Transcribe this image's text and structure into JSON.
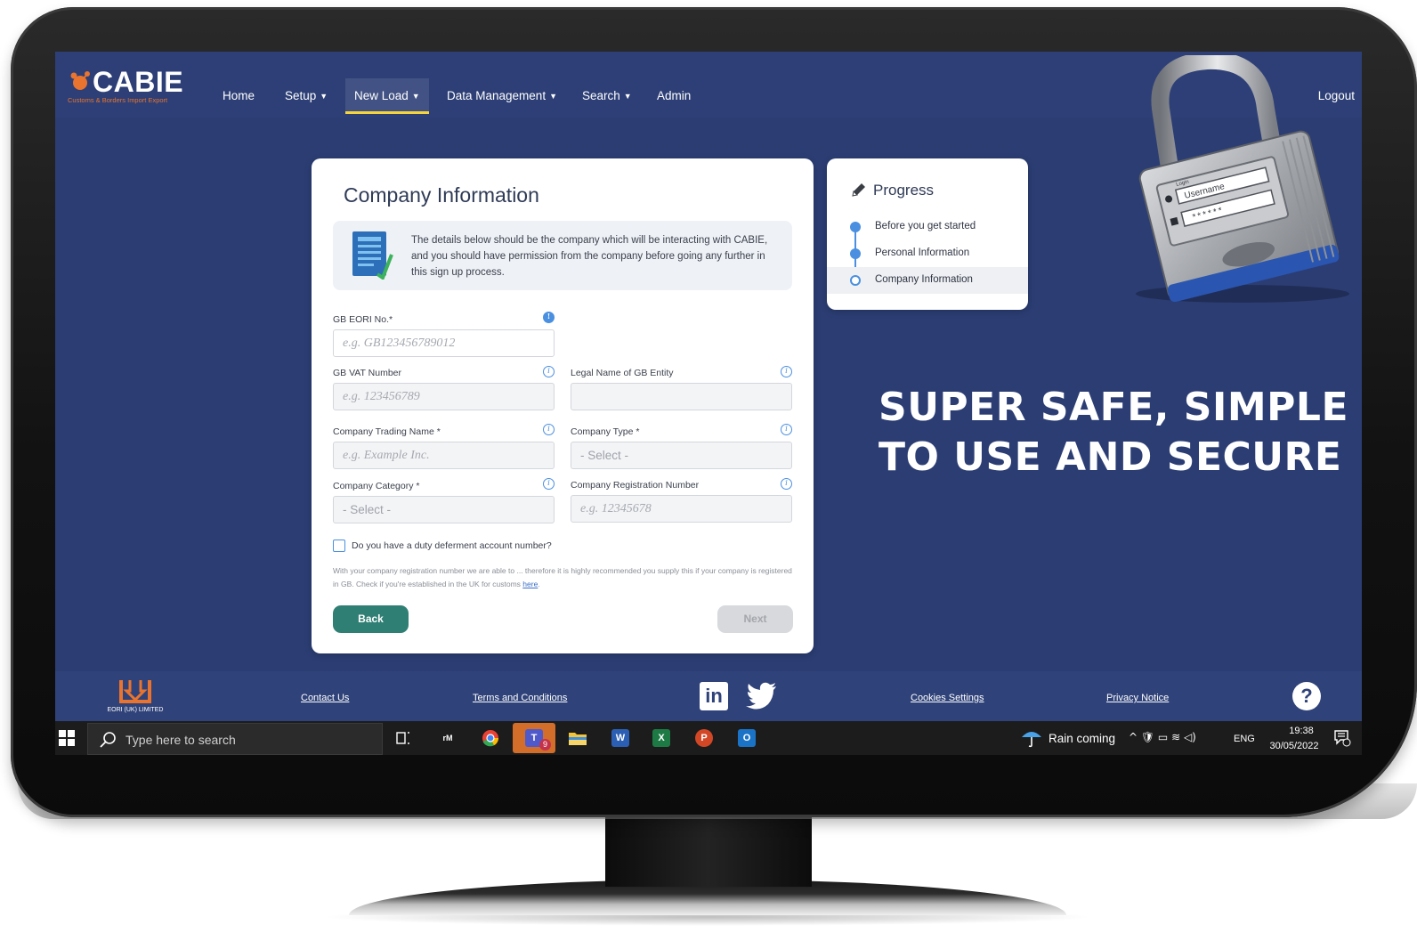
{
  "brand": {
    "name": "CABIE",
    "tagline": "Customs & Borders Import Export",
    "accent": "#e8742f",
    "primary": "#2b3d73"
  },
  "nav": {
    "items": [
      {
        "label": "Home",
        "has_menu": false
      },
      {
        "label": "Setup",
        "has_menu": true
      },
      {
        "label": "New Load",
        "has_menu": true,
        "active": true
      },
      {
        "label": "Data Management",
        "has_menu": true
      },
      {
        "label": "Search",
        "has_menu": true
      },
      {
        "label": "Admin",
        "has_menu": false
      }
    ],
    "logout": "Logout"
  },
  "form": {
    "title": "Company Information",
    "info_icon": "document-check-icon",
    "info_text": "The details below should be the company which will be interacting with CABIE, and you should have permission from the company before going any further in this sign up process.",
    "fields": {
      "eori": {
        "label": "GB EORI No.*",
        "placeholder": "e.g. GB123456789012"
      },
      "vat": {
        "label": "GB VAT Number",
        "placeholder": "e.g. 123456789"
      },
      "legal_name": {
        "label": "Legal Name of GB Entity",
        "placeholder": ""
      },
      "trading_name": {
        "label": "Company Trading Name *",
        "placeholder": "e.g. Example Inc."
      },
      "company_type": {
        "label": "Company Type *",
        "value": "- Select -"
      },
      "category": {
        "label": "Company Category *",
        "value": "- Select -"
      },
      "reg_number": {
        "label": "Company Registration Number",
        "placeholder": "e.g. 12345678"
      }
    },
    "duty_checkbox": {
      "label": "Do you have a duty deferment account number?",
      "checked": false
    },
    "note": "With your company registration number we are able to ... therefore it is highly recommended you supply this if your company is registered in GB. Check if you're established in the UK for customs",
    "note_link": "here",
    "note_end": ".",
    "back": "Back",
    "next": "Next"
  },
  "progress": {
    "title": "Progress",
    "steps": [
      {
        "label": "Before you get started",
        "state": "done"
      },
      {
        "label": "Personal Information",
        "state": "done"
      },
      {
        "label": "Company Information",
        "state": "current"
      }
    ]
  },
  "lock_graphic": {
    "field_username": "Username",
    "field_login": "Login"
  },
  "slogan": {
    "line1": "SUPER SAFE, SIMPLE",
    "line2": "TO USE AND SECURE"
  },
  "footer": {
    "eori_logo_label": "EORI (UK) LIMITED",
    "links": [
      "Contact Us",
      "Terms and Conditions",
      "Cookies Settings",
      "Privacy Notice"
    ],
    "social": [
      "linkedin-icon",
      "twitter-icon"
    ],
    "linkedin_text": "in",
    "help": "?"
  },
  "taskbar": {
    "search_placeholder": "Type here to search",
    "apps": [
      "task-view-icon",
      "app-icon",
      "chrome-icon",
      "teams-icon",
      "file-explorer-icon",
      "word-icon",
      "excel-icon",
      "powerpoint-icon",
      "outlook-icon"
    ],
    "weather": "Rain coming",
    "tray": "^ 🛡 ▭ ≋ ◁)",
    "language": "ENG",
    "time": "19:38",
    "date": "30/05/2022",
    "teams_badge": "9"
  }
}
